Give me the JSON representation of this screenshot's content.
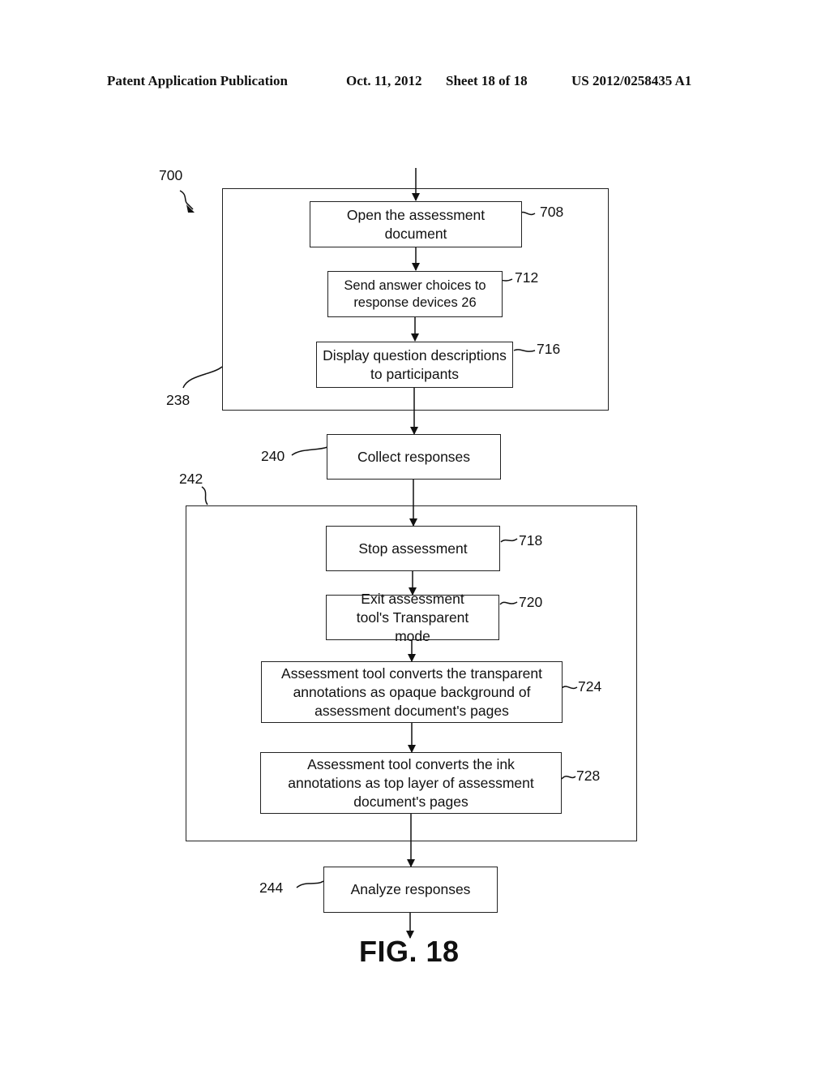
{
  "header": {
    "publication": "Patent Application Publication",
    "date": "Oct. 11, 2012",
    "sheet": "Sheet 18 of 18",
    "number": "US 2012/0258435 A1"
  },
  "diagram": {
    "figure_ref": "700",
    "groups": {
      "g238": {
        "ref": "238"
      },
      "g242": {
        "ref": "242"
      }
    },
    "steps": {
      "s708": {
        "ref": "708",
        "label": "Open the assessment document"
      },
      "s712": {
        "ref": "712",
        "label": "Send answer choices to response devices 26"
      },
      "s716": {
        "ref": "716",
        "label": "Display question descriptions to participants"
      },
      "s240": {
        "ref": "240",
        "label": "Collect responses"
      },
      "s718": {
        "ref": "718",
        "label": "Stop assessment"
      },
      "s720": {
        "ref": "720",
        "label": "Exit assessment tool's Transparent mode"
      },
      "s724": {
        "ref": "724",
        "label": "Assessment tool converts the transparent annotations as opaque background of assessment document's pages"
      },
      "s728": {
        "ref": "728",
        "label": "Assessment tool converts the ink annotations as top layer of assessment document's pages"
      },
      "s244": {
        "ref": "244",
        "label": "Analyze responses"
      }
    },
    "caption": "FIG. 18"
  }
}
